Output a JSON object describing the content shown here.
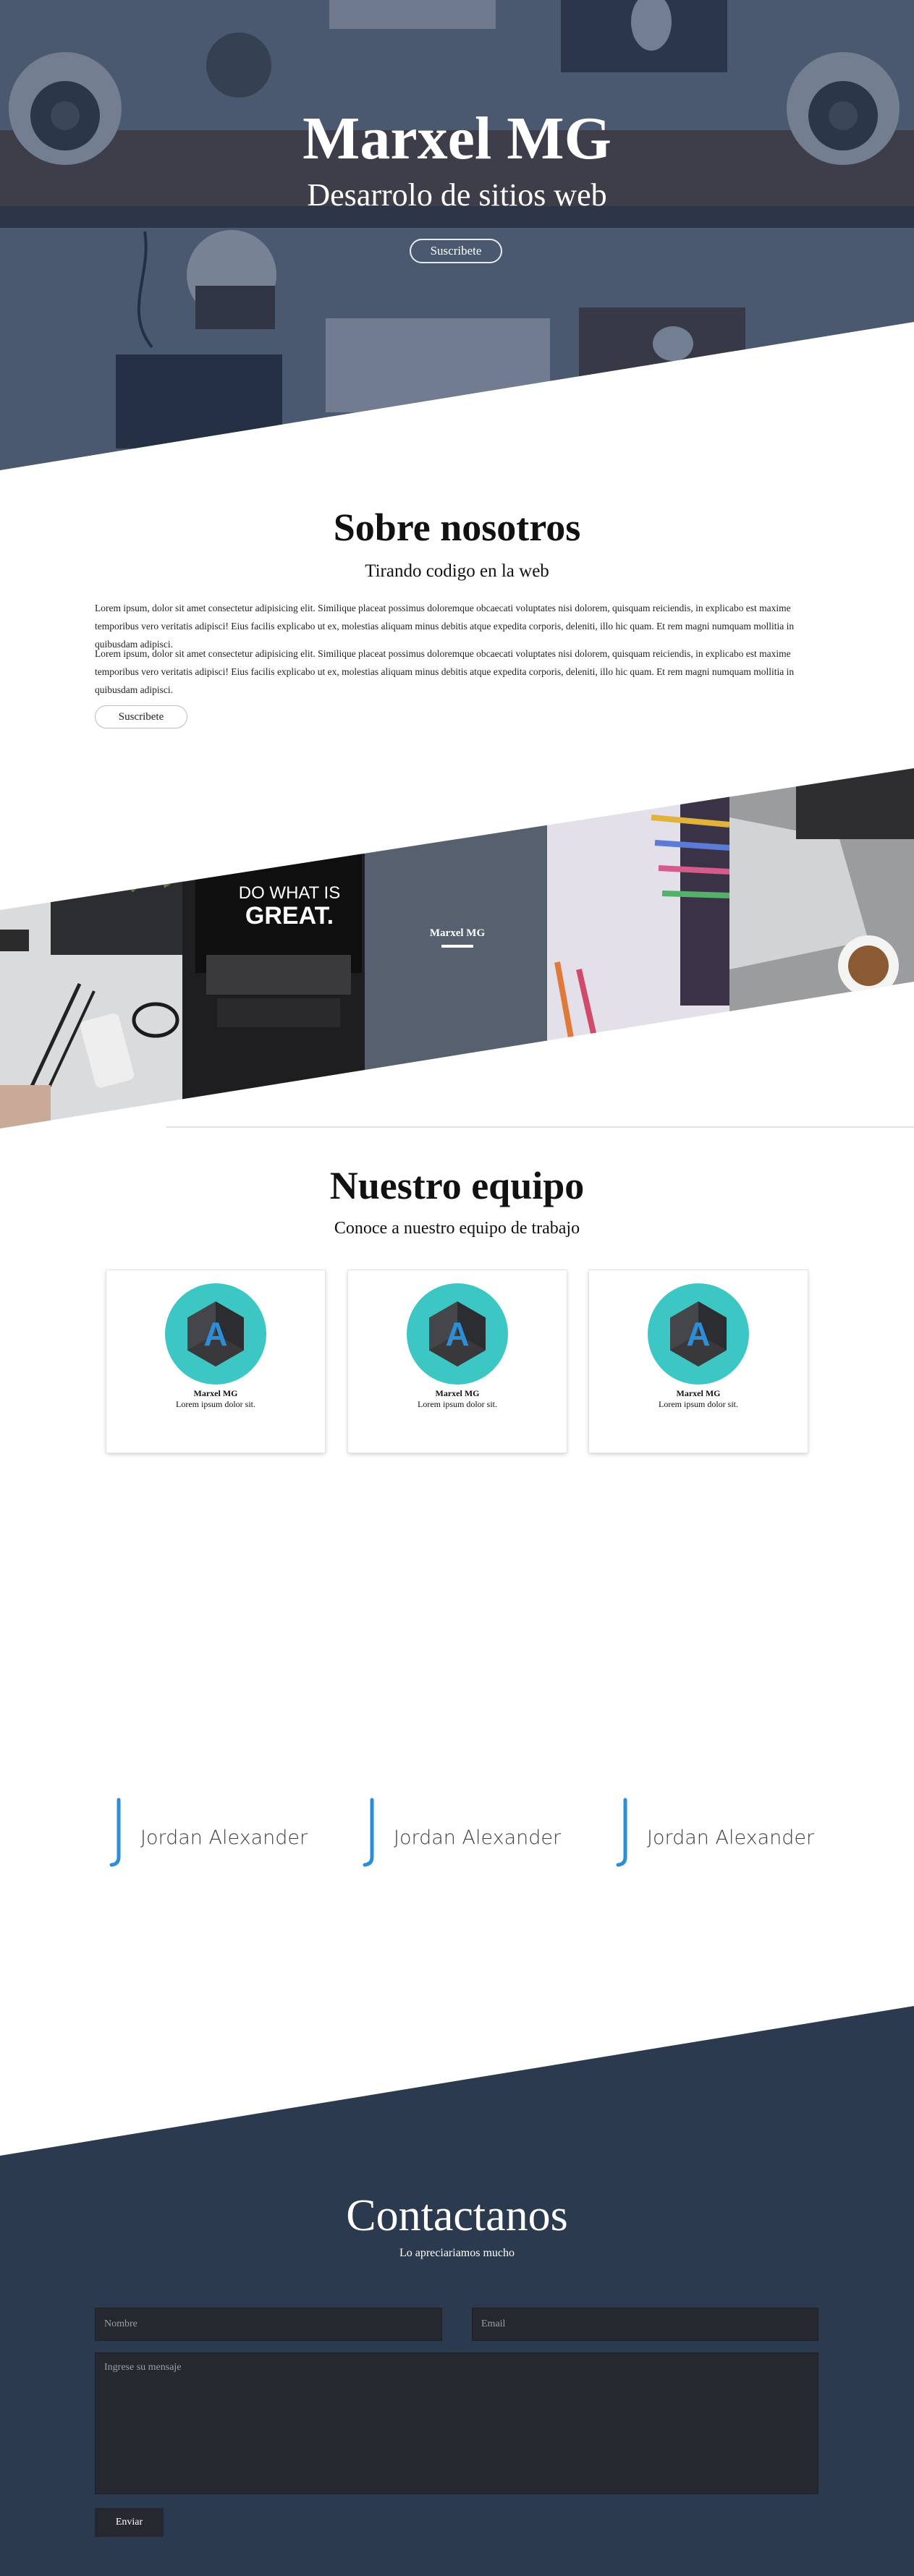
{
  "hero": {
    "title": "Marxel MG",
    "subtitle": "Desarrolo de sitios web",
    "button_label": "Suscribete"
  },
  "about": {
    "title": "Sobre nosotros",
    "subtitle": "Tirando codigo en la web",
    "paragraphs": [
      "Lorem ipsum, dolor sit amet consectetur adipisicing elit. Similique placeat possimus doloremque obcaecati voluptates nisi dolorem, quisquam reiciendis, in explicabo est maxime temporibus vero veritatis adipisci! Eius facilis explicabo ut ex, molestias aliquam minus debitis atque expedita corporis, deleniti, illo hic quam. Et rem magni numquam mollitia in quibusdam adipisci.",
      "Lorem ipsum, dolor sit amet consectetur adipisicing elit. Similique placeat possimus doloremque obcaecati voluptates nisi dolorem, quisquam reiciendis, in explicabo est maxime temporibus vero veritatis adipisci! Eius facilis explicabo ut ex, molestias aliquam minus debitis atque expedita corporis, deleniti, illo hic quam. Et rem magni numquam mollitia in quibusdam adipisci."
    ],
    "button_label": "Suscribete"
  },
  "gallery": {
    "overlay_label": "Marxel MG",
    "poster_line1": "DO WHAT IS",
    "poster_line2": "GREAT."
  },
  "team": {
    "title": "Nuestro equipo",
    "subtitle": "Conoce a nuestro equipo de trabajo",
    "members": [
      {
        "name": "Marxel MG",
        "description": "Lorem ipsum dolor sit.",
        "logo_letter": "A"
      },
      {
        "name": "Marxel MG",
        "description": "Lorem ipsum dolor sit.",
        "logo_letter": "A"
      },
      {
        "name": "Marxel MG",
        "description": "Lorem ipsum dolor sit.",
        "logo_letter": "A"
      }
    ]
  },
  "testimonials": [
    {
      "name": "Jordan Alexander"
    },
    {
      "name": "Jordan Alexander"
    },
    {
      "name": "Jordan Alexander"
    }
  ],
  "contact": {
    "title": "Contactanos",
    "subtitle": "Lo apreciariamos mucho",
    "name_placeholder": "Nombre",
    "email_placeholder": "Email",
    "message_placeholder": "Ingrese su mensaje",
    "send_label": "Enviar"
  },
  "colors": {
    "hero_overlay": "#2c3e5c",
    "contact_bg": "#2c3a4f",
    "field_bg": "#25292f",
    "accent_blue": "#2d8ed8",
    "logo_teal": "#3cc7c4",
    "gallery_overlay": "#56606e"
  },
  "icons": {
    "team_logo": "hexagon-a-logo-icon",
    "quote_mark": "bracket-quote-icon"
  }
}
